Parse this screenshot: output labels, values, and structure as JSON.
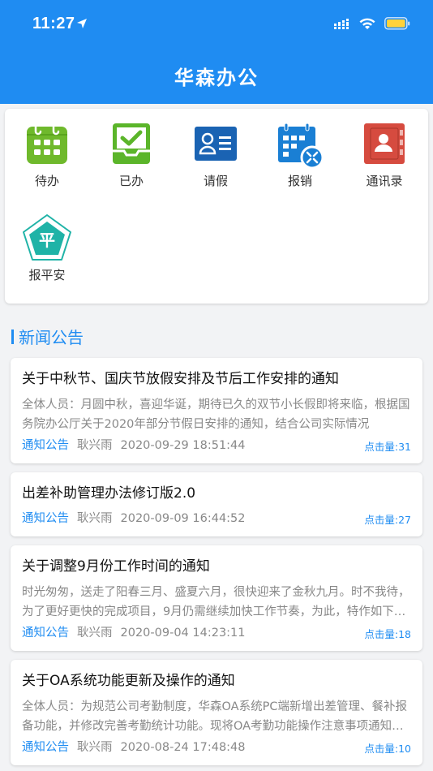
{
  "status_bar": {
    "time": "11:27"
  },
  "header": {
    "title": "华森办公"
  },
  "quick_menu": [
    {
      "id": "todo",
      "label": "待办",
      "icon": "calendar-grid-icon",
      "color": "#6fb92c"
    },
    {
      "id": "done",
      "label": "已办",
      "icon": "inbox-check-icon",
      "color": "#5bb52a"
    },
    {
      "id": "leave",
      "label": "请假",
      "icon": "id-card-icon",
      "color": "#1a63b3"
    },
    {
      "id": "reimburse",
      "label": "报销",
      "icon": "calendar-badge-icon",
      "color": "#1a7fd4"
    },
    {
      "id": "contacts",
      "label": "通讯录",
      "icon": "address-book-icon",
      "color": "#d64b3f"
    },
    {
      "id": "safety",
      "label": "报平安",
      "icon": "pentagon-badge-icon",
      "color": "#1fb3a7",
      "glyph": "平"
    }
  ],
  "news_section": {
    "title": "新闻公告"
  },
  "news": [
    {
      "title": "关于中秋节、国庆节放假安排及节后工作安排的通知",
      "summary": "全体人员：月圆中秋，喜迎华诞，期待已久的双节小长假即将来临，根据国务院办公厅关于2020年部分节假日安排的通知，结合公司实际情况",
      "category": "通知公告",
      "author": "耿兴雨",
      "date": "2020-09-29 18:51:44",
      "clicks": "点击量:31"
    },
    {
      "title": "出差补助管理办法修订版2.0",
      "summary": "",
      "category": "通知公告",
      "author": "耿兴雨",
      "date": "2020-09-09 16:44:52",
      "clicks": "点击量:27"
    },
    {
      "title": "关于调整9月份工作时间的通知",
      "summary": "时光匆匆，送走了阳春三月、盛夏六月，很快迎来了金秋九月。时不我待，为了更好更快的完成项目，9月仍需继续加快工作节奏，为此，特作如下调整",
      "category": "通知公告",
      "author": "耿兴雨",
      "date": "2020-09-04 14:23:11",
      "clicks": "点击量:18"
    },
    {
      "title": "关于OA系统功能更新及操作的通知",
      "summary": "全体人员：为规范公司考勤制度，华森OA系统PC端新增出差管理、餐补报备功能，并修改完善考勤统计功能。现将OA考勤功能操作注意事项通知如下",
      "category": "通知公告",
      "author": "耿兴雨",
      "date": "2020-08-24 17:48:48",
      "clicks": "点击量:10"
    }
  ]
}
